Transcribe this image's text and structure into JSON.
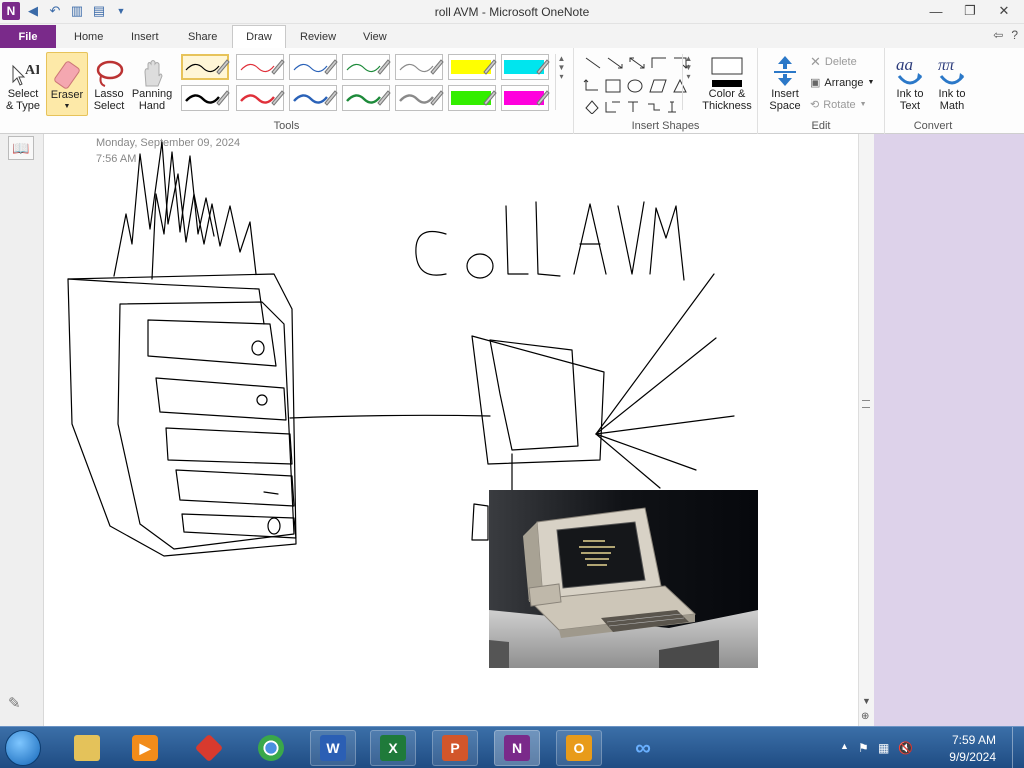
{
  "window": {
    "title": "roll AVM  -  Microsoft OneNote",
    "app_logo": "N",
    "controls": [
      "minimize-icon",
      "restore-icon",
      "close-icon"
    ]
  },
  "tabs": [
    {
      "label": "File"
    },
    {
      "label": "Home"
    },
    {
      "label": "Insert"
    },
    {
      "label": "Share"
    },
    {
      "label": "Draw"
    },
    {
      "label": "Review"
    },
    {
      "label": "View"
    }
  ],
  "ribbon": {
    "tools_label": "Tools",
    "select_type": "Select\n& Type",
    "select_line1": "Select",
    "select_line2": "& Type",
    "eraser": "Eraser",
    "lasso_line1": "Lasso",
    "lasso_line2": "Select",
    "panning_line1": "Panning",
    "panning_line2": "Hand",
    "insert_shapes_label": "Insert Shapes",
    "color_line1": "Color &",
    "color_line2": "Thickness",
    "insert_space_line1": "Insert",
    "insert_space_line2": "Space",
    "edit_label": "Edit",
    "delete": "Delete",
    "arrange": "Arrange",
    "rotate": "Rotate",
    "convert_label": "Convert",
    "ink_text_line1": "Ink to",
    "ink_text_line2": "Text",
    "ink_math_line1": "Ink to",
    "ink_math_line2": "Math",
    "pen_colors": [
      "#000000",
      "#e0303a",
      "#2a62b8",
      "#1d8a3a",
      "#8a8a8a",
      "#ffff00",
      "#00e5ee",
      "#000000",
      "#e0303a",
      "#2a62b8",
      "#1d8a3a",
      "#8a8a8a",
      "#33ee00",
      "#ff00dd"
    ]
  },
  "page": {
    "date": "Monday, September  09, 2024",
    "time": "7:56 AM",
    "handwriting": "CoLLAVM"
  },
  "taskbar": {
    "apps": [
      {
        "name": "explorer",
        "glyph": ""
      },
      {
        "name": "media",
        "glyph": ""
      },
      {
        "name": "gimp",
        "glyph": ""
      },
      {
        "name": "chrome",
        "glyph": ""
      },
      {
        "name": "word",
        "glyph": "W"
      },
      {
        "name": "excel",
        "glyph": "X"
      },
      {
        "name": "powerpoint",
        "glyph": "P"
      },
      {
        "name": "onenote",
        "glyph": "N"
      },
      {
        "name": "outlook",
        "glyph": "O"
      },
      {
        "name": "infinity",
        "glyph": "∞"
      }
    ],
    "clock_time": "7:59 AM",
    "clock_date": "9/9/2024"
  }
}
